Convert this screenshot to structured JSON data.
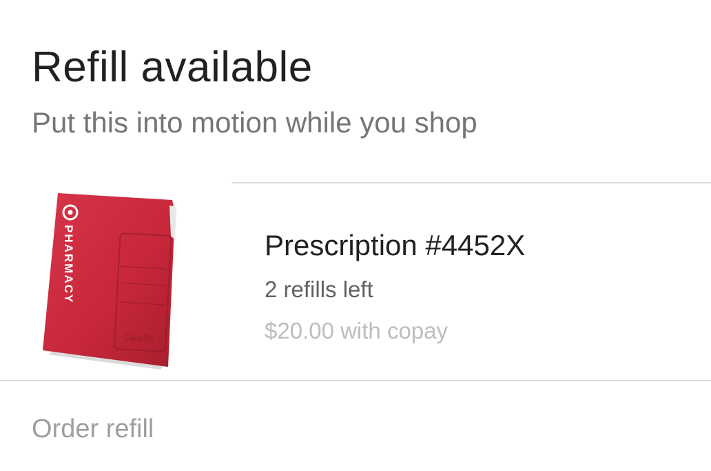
{
  "card": {
    "title": "Refill available",
    "subtitle": "Put this into motion while you shop"
  },
  "prescription": {
    "name": "Prescription #4452X",
    "refills": "2 refills left",
    "price": "$20.00 with copay",
    "image": {
      "icon": "pharmacy-bag-icon",
      "brand_text": "PHARMACY",
      "label_text": "ClearRx",
      "color": "#c8283a"
    }
  },
  "actions": {
    "order_refill": "Order refill"
  },
  "colors": {
    "title": "#212121",
    "subtitle": "#757575",
    "price": "#bdbdbd",
    "action": "#9e9e9e",
    "divider": "#dddddd"
  }
}
